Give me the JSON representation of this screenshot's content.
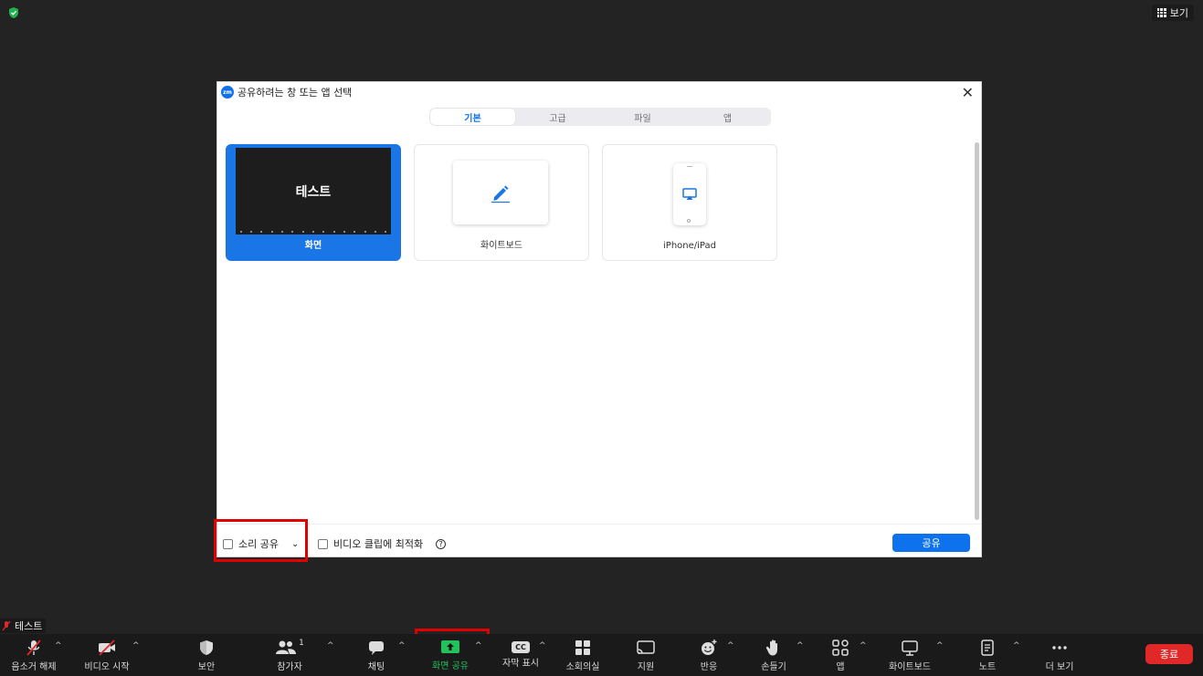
{
  "topbar": {
    "view_label": "보기"
  },
  "dialog": {
    "title": "공유하려는 창 또는 앱 선택",
    "close_glyph": "✕",
    "tabs": [
      {
        "label": "기본",
        "active": true
      },
      {
        "label": "고급"
      },
      {
        "label": "파일"
      },
      {
        "label": "앱"
      }
    ],
    "cards": [
      {
        "label": "화면",
        "thumb_text": "테스트",
        "selected": true
      },
      {
        "label": "화이트보드"
      },
      {
        "label": "iPhone/iPad"
      }
    ],
    "share_audio_label": "소리 공유",
    "optimize_video_label": "비디오 클립에 최적화",
    "help_glyph": "?",
    "share_button": "공유"
  },
  "self_view": {
    "name": "테스트"
  },
  "toolbar": {
    "items": [
      {
        "label": "음소거 해제"
      },
      {
        "label": "비디오 시작"
      },
      {
        "label": "보안"
      },
      {
        "label": "참가자",
        "count": "1"
      },
      {
        "label": "채팅"
      },
      {
        "label": "화면 공유"
      },
      {
        "label": "자막 표시",
        "badge": "CC"
      },
      {
        "label": "소회의실"
      },
      {
        "label": "지원"
      },
      {
        "label": "반응"
      },
      {
        "label": "손들기"
      },
      {
        "label": "앱"
      },
      {
        "label": "화이트보드"
      },
      {
        "label": "노트"
      },
      {
        "label": "더 보기"
      }
    ],
    "end_button": "종료",
    "caret": "^",
    "dropdown": "⌄"
  },
  "colors": {
    "accent": "#0e72ed",
    "share_green": "#22c25a",
    "end_red": "#e02828",
    "highlight_red": "#e10000"
  }
}
